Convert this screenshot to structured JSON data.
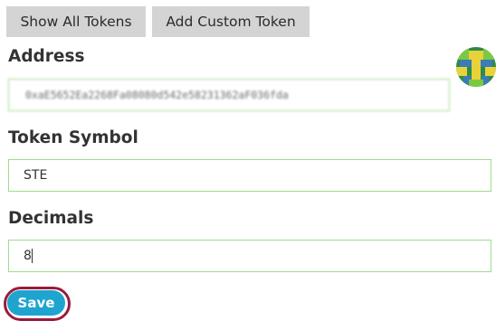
{
  "tabs": {
    "show_all_label": "Show All Tokens",
    "add_custom_label": "Add Custom Token"
  },
  "form": {
    "address_label": "Address",
    "address_value": "0xaE5652Ea2268Fa08080d542e58231362aF036fda",
    "symbol_label": "Token Symbol",
    "symbol_value": "STE",
    "decimals_label": "Decimals",
    "decimals_value": "8",
    "save_label": "Save"
  },
  "identicon": {
    "icon": "identicon-icon",
    "colors": [
      "#2e8a4c",
      "#e8d23a",
      "#3a7bb8",
      "#7ac943"
    ]
  },
  "colors": {
    "input_border": "#9fdc8f",
    "save_button": "#1ea4cf",
    "save_focus_ring": "#9a1b3c",
    "tab_background": "#d4d4d4"
  }
}
